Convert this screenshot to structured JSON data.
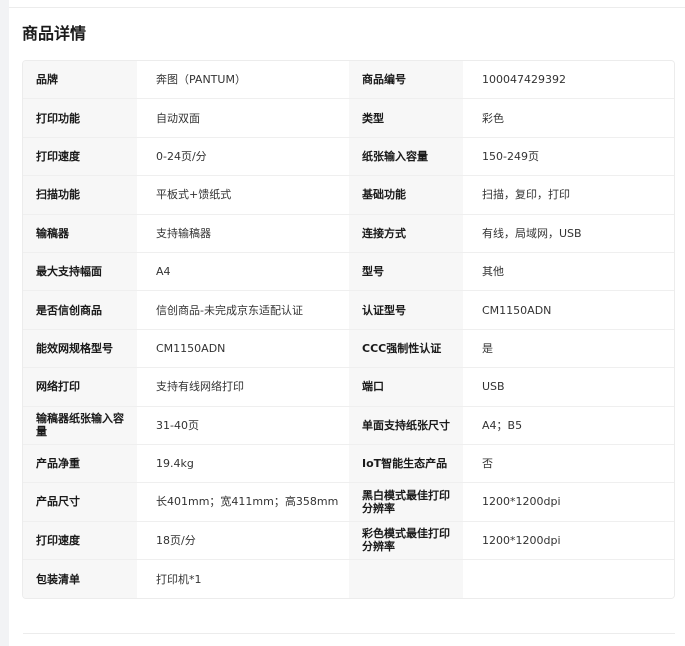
{
  "section": {
    "title": "商品详情"
  },
  "specs": [
    {
      "k1": "品牌",
      "v1": "奔图（PANTUM）",
      "k2": "商品编号",
      "v2": "100047429392"
    },
    {
      "k1": "打印功能",
      "v1": "自动双面",
      "k2": "类型",
      "v2": "彩色"
    },
    {
      "k1": "打印速度",
      "v1": "0-24页/分",
      "k2": "纸张输入容量",
      "v2": "150-249页"
    },
    {
      "k1": "扫描功能",
      "v1": "平板式+馈纸式",
      "k2": "基础功能",
      "v2": "扫描，复印，打印"
    },
    {
      "k1": "输稿器",
      "v1": "支持输稿器",
      "k2": "连接方式",
      "v2": "有线，局域网，USB"
    },
    {
      "k1": "最大支持幅面",
      "v1": "A4",
      "k2": "型号",
      "v2": "其他"
    },
    {
      "k1": "是否信创商品",
      "v1": "信创商品-未完成京东适配认证",
      "k2": "认证型号",
      "v2": "CM1150ADN"
    },
    {
      "k1": "能效网规格型号",
      "v1": "CM1150ADN",
      "k2": "CCC强制性认证",
      "v2": "是"
    },
    {
      "k1": "网络打印",
      "v1": "支持有线网络打印",
      "k2": "端口",
      "v2": "USB"
    },
    {
      "k1": "输稿器纸张输入容量",
      "v1": "31-40页",
      "k2": "单面支持纸张尺寸",
      "v2": "A4；B5"
    },
    {
      "k1": "产品净重",
      "v1": "19.4kg",
      "k2": "IoT智能生态产品",
      "v2": "否"
    },
    {
      "k1": "产品尺寸",
      "v1": "长401mm；宽411mm；高358mm",
      "k2": "黑白模式最佳打印分辨率",
      "v2": "1200*1200dpi"
    },
    {
      "k1": "打印速度",
      "v1": "18页/分",
      "k2": "彩色模式最佳打印分辨率",
      "v2": "1200*1200dpi"
    },
    {
      "k1": "包装清单",
      "v1": "打印机*1",
      "k2": "",
      "v2": ""
    }
  ]
}
